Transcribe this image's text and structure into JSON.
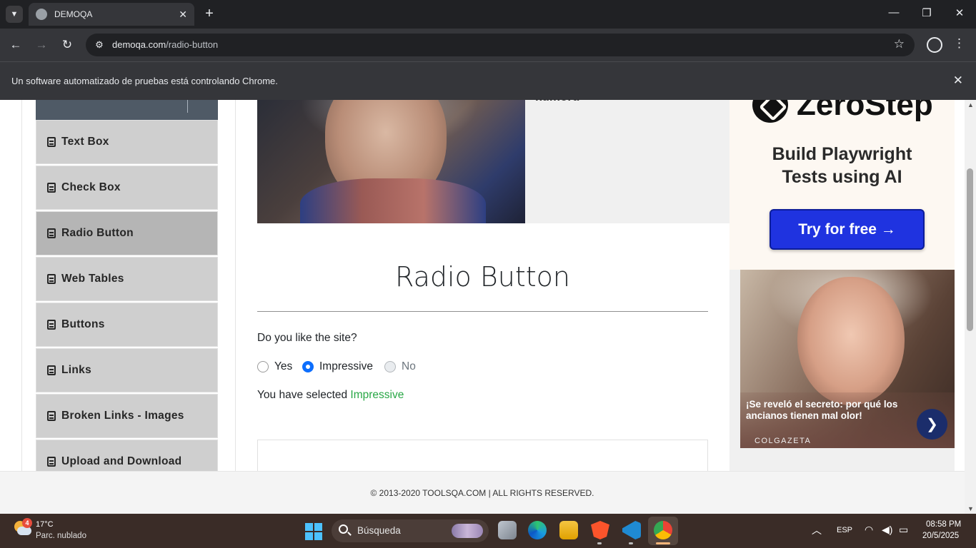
{
  "browser": {
    "tab_title": "DEMOQA",
    "url_host": "demoqa.com",
    "url_path": "/radio-button",
    "infobar_text": "Un software automatizado de pruebas está controlando Chrome."
  },
  "sidebar": {
    "items": [
      {
        "label": "Text Box",
        "active": false
      },
      {
        "label": "Check Box",
        "active": false
      },
      {
        "label": "Radio Button",
        "active": true
      },
      {
        "label": "Web Tables",
        "active": false
      },
      {
        "label": "Buttons",
        "active": false
      },
      {
        "label": "Links",
        "active": false
      },
      {
        "label": "Broken Links - Images",
        "active": false
      },
      {
        "label": "Upload and Download",
        "active": false
      }
    ]
  },
  "banner": {
    "partial_text": "kumoru"
  },
  "main": {
    "title": "Radio Button",
    "question": "Do you like the site?",
    "options": [
      {
        "label": "Yes",
        "checked": false,
        "disabled": false
      },
      {
        "label": "Impressive",
        "checked": true,
        "disabled": false
      },
      {
        "label": "No",
        "checked": false,
        "disabled": true
      }
    ],
    "result_prefix": "You have selected ",
    "result_value": "Impressive"
  },
  "ads": {
    "zerostep": {
      "brand": "ZeroStep",
      "headline_line1": "Build Playwright",
      "headline_line2": "Tests using AI",
      "cta": "Try for free →"
    },
    "news": {
      "headline": "¡Se reveló el secreto: por qué los ancianos tienen mal olor!",
      "source": "COLGAZETA"
    }
  },
  "footer": {
    "text": "© 2013-2020 TOOLSQA.COM | ALL RIGHTS RESERVED."
  },
  "taskbar": {
    "weather_badge": "4",
    "weather_temp": "17°C",
    "weather_desc": "Parc. nublado",
    "search_placeholder": "Búsqueda",
    "language": "ESP",
    "time": "08:58 PM",
    "date": "20/5/2025"
  },
  "colors": {
    "accent_blue": "#0d6efd",
    "result_green": "#28a745",
    "zerostep_cta": "#1f33e0"
  }
}
